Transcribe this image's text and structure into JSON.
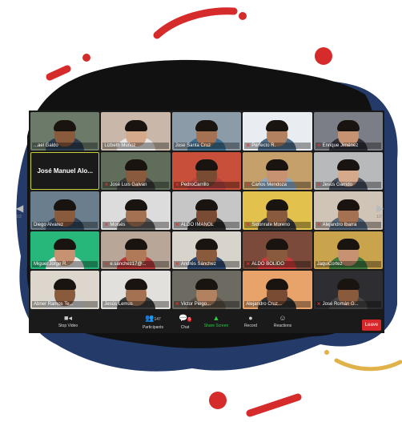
{
  "theme": {
    "accent_red": "#d52b2b",
    "accent_gold": "#e0b34a",
    "navy": "#243b6a",
    "share_green": "#2ecc40",
    "leave_red": "#d9262a"
  },
  "gallery": {
    "page_left": "1/2",
    "page_right": "1/2",
    "tiles": [
      {
        "name": "...ael Galdo",
        "muted": false,
        "bg": "#6c7a6a",
        "skin": "#8a5a3c",
        "shirt": "#2c3e50"
      },
      {
        "name": "Lizbeth Muñoz",
        "muted": false,
        "bg": "#c9b8a9",
        "skin": "#d4a98c",
        "shirt": "#e6e6e6"
      },
      {
        "name": "Jose Santa Cruz",
        "muted": false,
        "bg": "#8b9ba8",
        "skin": "#a47152",
        "shirt": "#3c6d8f"
      },
      {
        "name": "Perfecto R.",
        "muted": true,
        "bg": "#e9edf1",
        "skin": "#b28260",
        "shirt": "#4e6c8a"
      },
      {
        "name": "Enrique Jiménez",
        "muted": true,
        "bg": "#7b7e86",
        "skin": "#c69271",
        "shirt": "#2f2f3a"
      },
      {
        "name": "José Manuel Alo...",
        "muted": false,
        "bg": "#1a1a1a",
        "big": true
      },
      {
        "name": "José Luis Galvan",
        "muted": true,
        "bg": "#5f6d5a",
        "skin": "#8a5a3c",
        "shirt": "#3a3a3a"
      },
      {
        "name": "PedroCarrillo",
        "muted": true,
        "bg": "#c84f3a",
        "skin": "#7a4b33",
        "shirt": "#b54440"
      },
      {
        "name": "Carlos Mendoza",
        "muted": true,
        "bg": "#c5a06a",
        "skin": "#c69271",
        "shirt": "#8aa8c4"
      },
      {
        "name": "Jesús Garrido",
        "muted": true,
        "bg": "#b7b9ba",
        "skin": "#d4a98c",
        "shirt": "#444b5a"
      },
      {
        "name": "Diego Alvarez",
        "muted": false,
        "bg": "#6a7e8e",
        "skin": "#8a5a3c",
        "shirt": "#304458"
      },
      {
        "name": "Moisés",
        "muted": true,
        "bg": "#dcdcdc",
        "skin": "#a47152",
        "shirt": "#5a5a5a"
      },
      {
        "name": "ALDO IMANOL",
        "muted": true,
        "bg": "#c6c6c6",
        "skin": "#7a4b33",
        "shirt": "#2a2a2a"
      },
      {
        "name": "Sidonrate Moreno",
        "muted": true,
        "bg": "#e2c24d",
        "skin": "#8a5a3c",
        "shirt": "#3b3b3b"
      },
      {
        "name": "Alejandro Ibarra",
        "muted": true,
        "bg": "#cfc4b5",
        "skin": "#a47152",
        "shirt": "#54667a"
      },
      {
        "name": "Miguel Jorge R.",
        "muted": false,
        "bg": "#28b77a",
        "skin": "#c69271",
        "shirt": "#e8e8e8"
      },
      {
        "name": "e.sanchez17@...",
        "muted": true,
        "bg": "#b8a698",
        "skin": "#b07a58",
        "shirt": "#b53b3b"
      },
      {
        "name": "Andrés Sánchez",
        "muted": true,
        "bg": "#d8d3cb",
        "skin": "#8a5a3c",
        "shirt": "#2f4a6e"
      },
      {
        "name": "ALDO BOLIDO",
        "muted": true,
        "bg": "#7c4a3a",
        "skin": "#8a5a3c",
        "shirt": "#c83b3b"
      },
      {
        "name": "JaquiCortez",
        "muted": false,
        "bg": "#c9a44c",
        "skin": "#c69271",
        "shirt": "#3e7a3e"
      },
      {
        "name": "Abner Ramos Te...",
        "muted": false,
        "bg": "#ddd6cd",
        "skin": "#8a5a3c",
        "shirt": "#d8d8d8"
      },
      {
        "name": "Jesús Lemus",
        "muted": false,
        "bg": "#e2e0dc",
        "skin": "#a47152",
        "shirt": "#3a3a3a"
      },
      {
        "name": "Victor Piego...",
        "muted": true,
        "bg": "#6d6a62",
        "skin": "#b28260",
        "shirt": "#5a5046"
      },
      {
        "name": "Alejandro Cruz...",
        "muted": false,
        "bg": "#e8a36a",
        "skin": "#7a4b33",
        "shirt": "#2f2f2f"
      },
      {
        "name": "José Román G...",
        "muted": true,
        "bg": "#2e2e32",
        "skin": "#8a5a3c",
        "shirt": "#444"
      }
    ]
  },
  "toolbar": {
    "stop_video": "Stop Video",
    "participants": "Participants",
    "participants_count": "147",
    "chat": "Chat",
    "chat_badge": "5",
    "share_screen": "Share Screen",
    "record": "Record",
    "reactions": "Reactions",
    "leave": "Leave"
  }
}
